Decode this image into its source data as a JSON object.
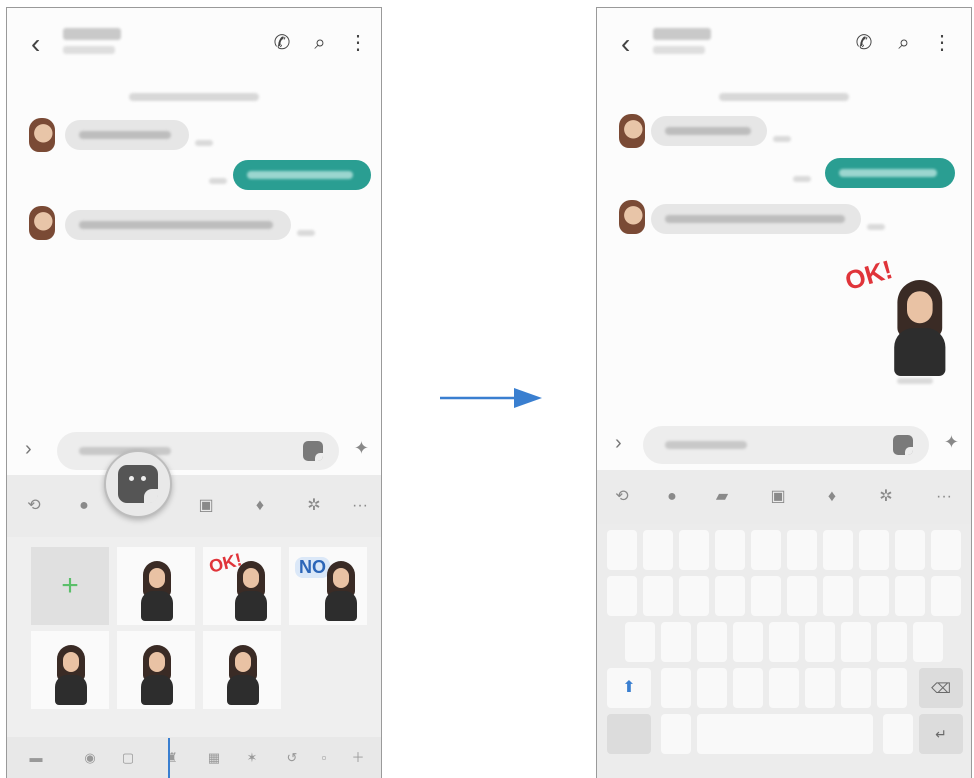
{
  "left_screen": {
    "header_icons": [
      "call-icon",
      "search-icon",
      "more-icon"
    ],
    "conversation": [
      "received",
      "sent",
      "received"
    ],
    "stickers": [
      {
        "label": ""
      },
      {
        "label": ""
      },
      {
        "label": "OK!"
      },
      {
        "label": "NO"
      },
      {
        "label": ""
      },
      {
        "label": ""
      },
      {
        "label": ""
      }
    ],
    "add_sticker_symbol": "+",
    "toolbar_icons": [
      "gif-icon",
      "emoji-icon",
      "sticker-icon",
      "image-icon",
      "mic-icon",
      "settings-icon",
      "more-icon"
    ]
  },
  "right_screen": {
    "sent_sticker_label": "OK!"
  },
  "accent_color": "#2a9e92",
  "arrow_color": "#3a7fd0"
}
